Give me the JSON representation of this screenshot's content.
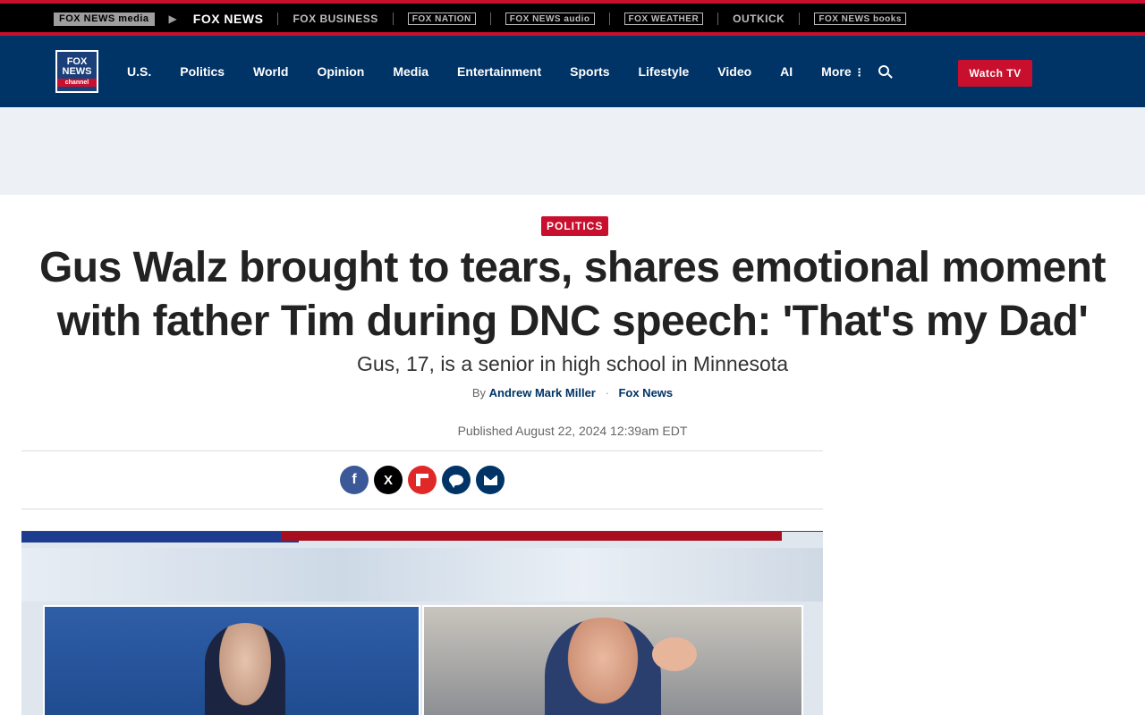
{
  "brand_bar": {
    "items": [
      {
        "label": "FOX NEWS media"
      },
      {
        "label": "FOX NEWS"
      },
      {
        "label": "FOX BUSINESS"
      },
      {
        "label": "FOX NATION"
      },
      {
        "label": "FOX NEWS audio"
      },
      {
        "label": "FOX WEATHER"
      },
      {
        "label": "OUTKICK"
      },
      {
        "label": "FOX NEWS books"
      }
    ]
  },
  "logo": {
    "line1": "FOX",
    "line2": "NEWS",
    "line3": "channel"
  },
  "nav": {
    "items": [
      {
        "label": "U.S."
      },
      {
        "label": "Politics"
      },
      {
        "label": "World"
      },
      {
        "label": "Opinion"
      },
      {
        "label": "Media"
      },
      {
        "label": "Entertainment"
      },
      {
        "label": "Sports"
      },
      {
        "label": "Lifestyle"
      },
      {
        "label": "Video"
      },
      {
        "label": "AI"
      },
      {
        "label": "More"
      }
    ],
    "watch_tv": "Watch TV"
  },
  "article": {
    "eyebrow": "POLITICS",
    "headline": "Gus Walz brought to tears, shares emotional moment with father Tim during DNC speech: 'That's my Dad'",
    "subhead": "Gus, 17, is a senior in high school in Minnesota",
    "byline_prefix": "By",
    "author": "Andrew Mark Miller",
    "source": "Fox News",
    "published": "Published August 22, 2024 12:39am EDT"
  },
  "share": {
    "facebook": "f",
    "x": "X"
  },
  "colors": {
    "brand_red": "#c8102e",
    "nav_blue": "#003366",
    "ad_band": "#edf1f5"
  }
}
